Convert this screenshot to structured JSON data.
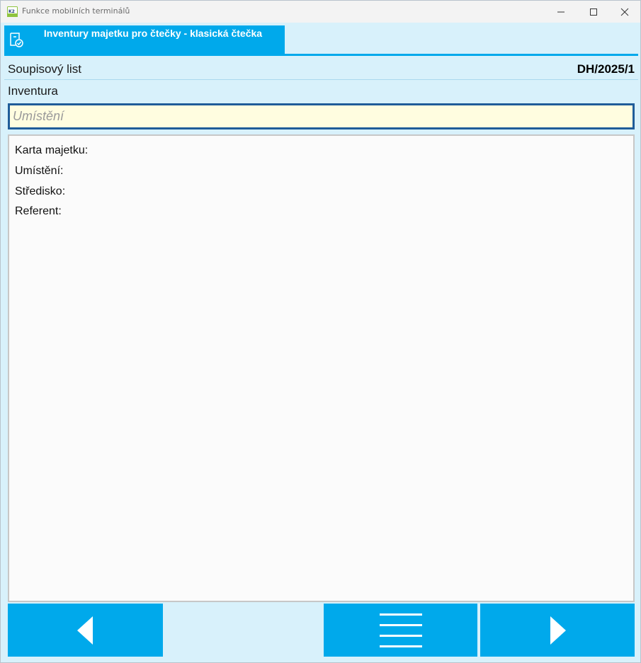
{
  "window": {
    "title": "Funkce mobilních terminálů",
    "icon": "k2-app-icon"
  },
  "tab": {
    "title": "Inventury majetku pro čtečky - klasická čtečka",
    "icon": "clipboard-check-icon"
  },
  "header": {
    "document_label": "Soupisový list",
    "document_value": "DH/2025/1",
    "inventory_label": "Inventura"
  },
  "input": {
    "placeholder": "Umístění",
    "value": ""
  },
  "info": {
    "lines": [
      "Karta majetku:",
      "Umístění:",
      "Středisko:",
      "Referent:"
    ]
  },
  "footer": {
    "buttons": [
      {
        "name": "previous",
        "icon": "triangle-left-icon"
      },
      {
        "name": "menu",
        "icon": "hamburger-menu-icon"
      },
      {
        "name": "next",
        "icon": "triangle-right-icon"
      }
    ]
  },
  "colors": {
    "accent": "#00a9eb",
    "background": "#d8f1fb",
    "input_bg": "#fffde0",
    "input_border": "#1f5c99"
  }
}
